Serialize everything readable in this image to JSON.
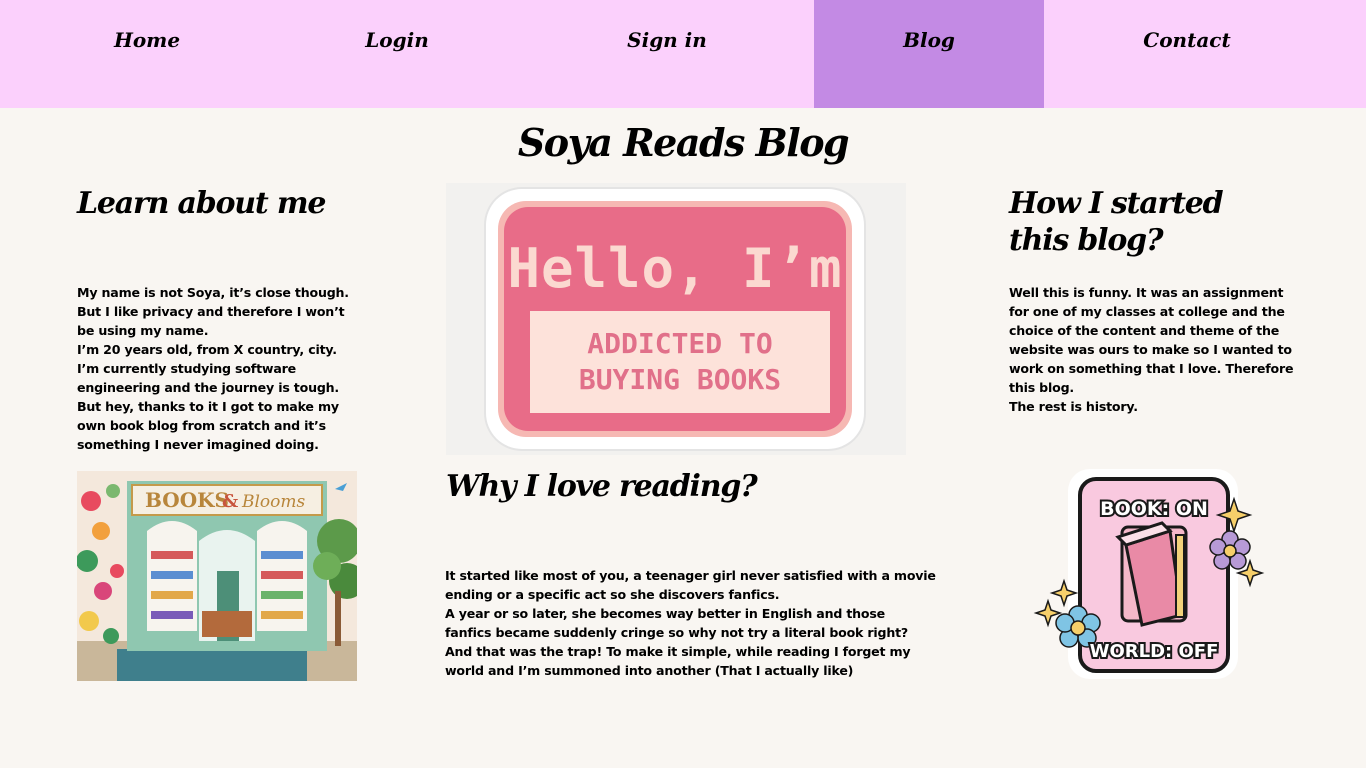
{
  "nav": {
    "items": [
      {
        "label": "Home"
      },
      {
        "label": "Login"
      },
      {
        "label": "Sign in"
      },
      {
        "label": "Blog"
      },
      {
        "label": "Contact"
      }
    ]
  },
  "page": {
    "title": "Soya Reads Blog"
  },
  "about": {
    "heading": "Learn about me",
    "lines": [
      "My name is not Soya, it’s close though.",
      "But I like privacy and therefore I won’t",
      "be using my name.",
      "I’m 20 years old, from X country, city.",
      "I’m currently studying software",
      "engineering and the journey is tough.",
      "But hey, thanks to it I got to make my",
      "own book blog from scratch and it’s",
      "something I never imagined doing."
    ]
  },
  "started": {
    "heading_line1": "How I started",
    "heading_line2": "this blog?",
    "lines": [
      "Well this is funny. It was an assignment",
      "for one of my classes at college and the",
      "choice of the content and theme of the",
      "website was ours to make so I wanted to",
      "work on something that I love.  Therefore",
      "this blog.",
      "The rest is history."
    ]
  },
  "reading": {
    "heading": "Why I love reading?",
    "lines": [
      "It started like most of you, a teenager girl never satisfied with a movie",
      "ending or a specific act so she discovers fanfics.",
      "A year or so later, she becomes way better in English and those",
      "fanfics became suddenly cringe so why not try a literal book right?",
      "And that was the trap! To make it simple, while reading I forget my",
      "world and I’m summoned into another (That I actually like)"
    ]
  },
  "hello_sticker": {
    "title": "Hello, I’m",
    "line1": "ADDICTED TO",
    "line2": "BUYING BOOKS"
  },
  "store_image": {
    "sign_books": "BOOKS",
    "sign_amp": "&",
    "sign_blooms": "Blooms"
  },
  "book_sticker": {
    "top": "BOOK: ON",
    "bottom": "WORLD: OFF"
  },
  "colors": {
    "nav_bg": "#fbd0fc",
    "nav_active": "#c38ae4",
    "page_bg": "#f9f6f2",
    "sticker_pink": "#e86c88"
  }
}
